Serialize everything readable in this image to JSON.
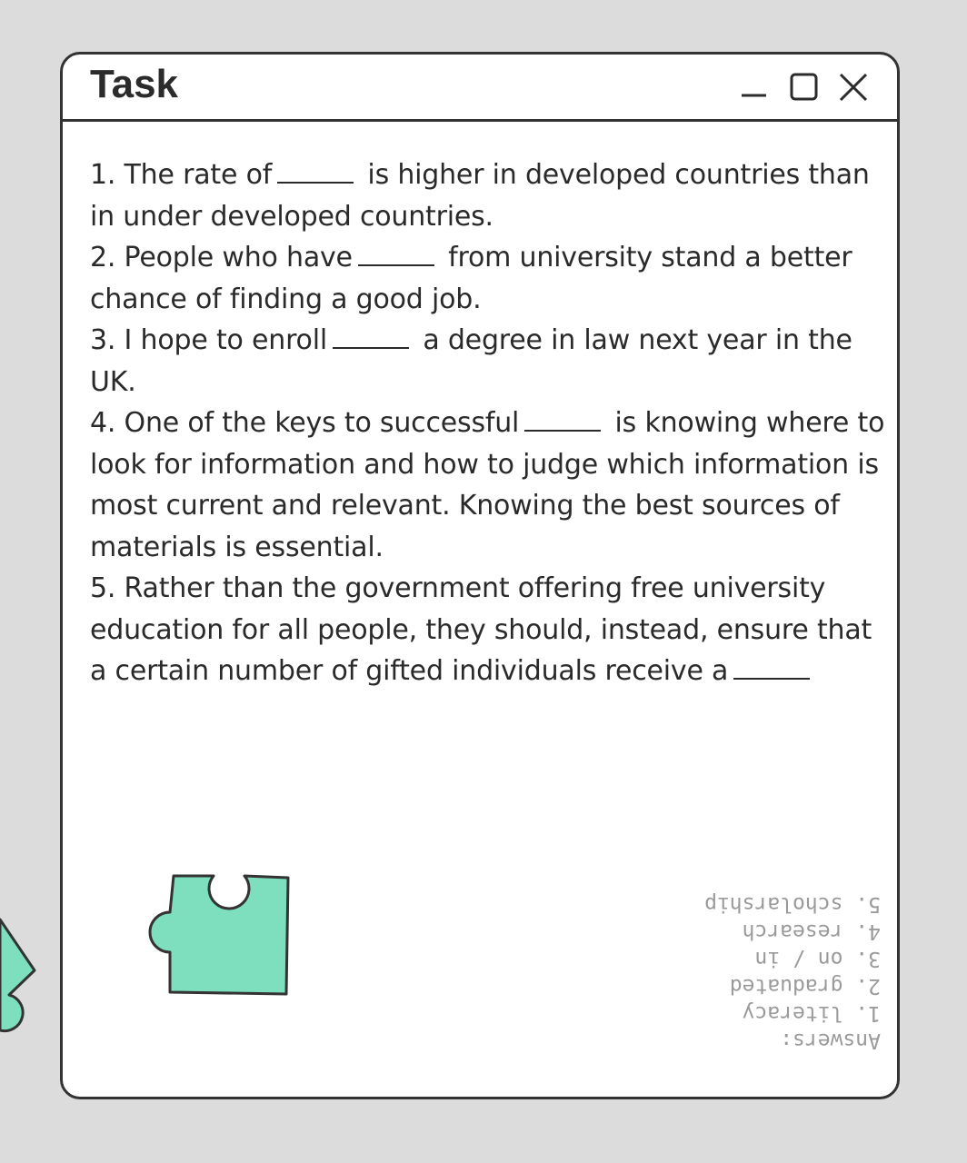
{
  "window": {
    "title": "Task",
    "minimize_icon": "minimize-icon",
    "maximize_icon": "maximize-icon",
    "close_icon": "close-icon"
  },
  "questions": [
    {
      "before": "1. The rate of",
      "after": " is higher in developed countries than in under developed countries."
    },
    {
      "before": "2. People who have",
      "after": " from university stand a better chance of finding a good job."
    },
    {
      "before": "3. I hope to enroll",
      "after": " a degree in law next year in the UK."
    },
    {
      "before": "4. One of the keys to successful",
      "after": " is knowing where to look for information and how to judge which information is most current and relevant. Knowing the best sources of materials is essential."
    },
    {
      "before": "5. Rather than the government offering free university education for all people, they should, instead, ensure that a certain number of gifted individuals receive a",
      "after": ""
    }
  ],
  "answers": {
    "heading": "Answers:",
    "items": [
      "1. literacy",
      "2. graduated",
      "3. on / in",
      "4. research",
      "5. scholarship"
    ]
  },
  "colors": {
    "puzzle": "#7ddfbd",
    "outline": "#333333",
    "answers_text": "#9a9a9a"
  }
}
